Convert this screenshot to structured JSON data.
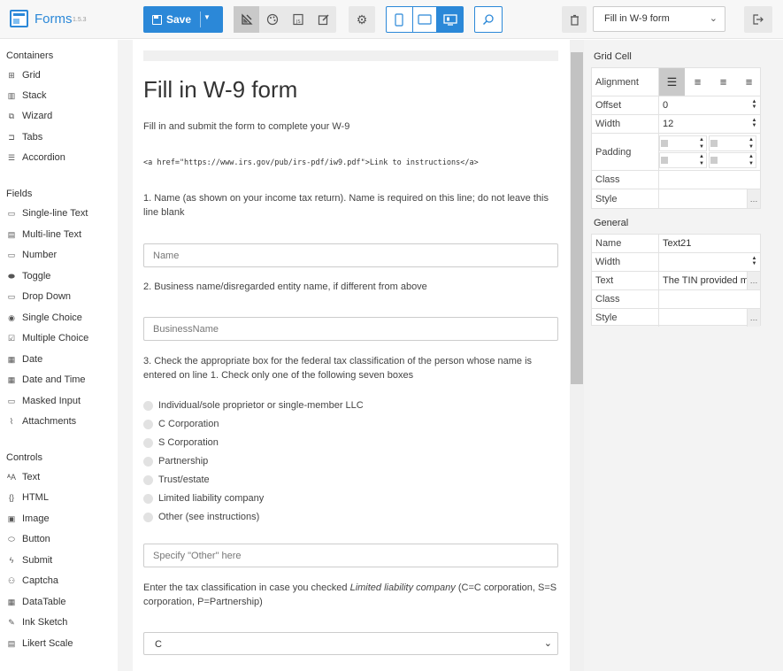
{
  "app": {
    "title": "Forms",
    "version": "1.5.3",
    "save_label": "Save"
  },
  "toolbar": {
    "form_select": "Fill in W-9 form"
  },
  "toolbox": {
    "containers_title": "Containers",
    "containers": [
      {
        "label": "Grid",
        "icon": "grid-icon"
      },
      {
        "label": "Stack",
        "icon": "stack-icon"
      },
      {
        "label": "Wizard",
        "icon": "wizard-icon"
      },
      {
        "label": "Tabs",
        "icon": "tabs-icon"
      },
      {
        "label": "Accordion",
        "icon": "accordion-icon"
      }
    ],
    "fields_title": "Fields",
    "fields": [
      {
        "label": "Single-line Text",
        "icon": "single-line-text-icon"
      },
      {
        "label": "Multi-line Text",
        "icon": "multi-line-text-icon"
      },
      {
        "label": "Number",
        "icon": "number-icon"
      },
      {
        "label": "Toggle",
        "icon": "toggle-icon"
      },
      {
        "label": "Drop Down",
        "icon": "drop-down-icon"
      },
      {
        "label": "Single Choice",
        "icon": "single-choice-icon"
      },
      {
        "label": "Multiple Choice",
        "icon": "multiple-choice-icon"
      },
      {
        "label": "Date",
        "icon": "date-icon"
      },
      {
        "label": "Date and Time",
        "icon": "date-time-icon"
      },
      {
        "label": "Masked Input",
        "icon": "masked-input-icon"
      },
      {
        "label": "Attachments",
        "icon": "attachments-icon"
      }
    ],
    "controls_title": "Controls",
    "controls": [
      {
        "label": "Text",
        "icon": "text-icon"
      },
      {
        "label": "HTML",
        "icon": "html-icon"
      },
      {
        "label": "Image",
        "icon": "image-icon"
      },
      {
        "label": "Button",
        "icon": "button-icon"
      },
      {
        "label": "Submit",
        "icon": "submit-icon"
      },
      {
        "label": "Captcha",
        "icon": "captcha-icon"
      },
      {
        "label": "DataTable",
        "icon": "datatable-icon"
      },
      {
        "label": "Ink Sketch",
        "icon": "ink-sketch-icon"
      },
      {
        "label": "Likert Scale",
        "icon": "likert-scale-icon"
      }
    ]
  },
  "form": {
    "title": "Fill in W-9 form",
    "intro": "Fill in and submit the form to complete your W-9",
    "link_html": "<a href=\"https://www.irs.gov/pub/irs-pdf/iw9.pdf\">Link to instructions</a>",
    "q1": "1. Name (as shown on your income tax return). Name is required on this line; do not leave this line blank",
    "name_placeholder": "Name",
    "q2": "2. Business name/disregarded entity name, if different from above",
    "business_placeholder": "BusinessName",
    "q3": "3. Check the appropriate box for the federal tax classification of the person whose name is entered on line 1. Check only one of the following seven boxes",
    "classifications": [
      "Individual/sole proprietor or single-member LLC",
      "C Corporation",
      "S Corporation",
      "Partnership",
      "Trust/estate",
      "Limited liability company",
      "Other (see instructions)"
    ],
    "other_placeholder": "Specify \"Other\" here",
    "tax_note_pre": "Enter the tax classification in case you checked ",
    "tax_note_em": "Limited liability company",
    "tax_note_post": " (C=C corporation, S=S corporation, P=Partnership)",
    "tax_select": "C"
  },
  "props": {
    "grid_cell_title": "Grid Cell",
    "alignment_label": "Alignment",
    "offset_label": "Offset",
    "offset_value": "0",
    "width_label": "Width",
    "width_value": "12",
    "padding_label": "Padding",
    "class_label": "Class",
    "style_label": "Style",
    "general_title": "General",
    "g_name_label": "Name",
    "g_name_value": "Text21",
    "g_width_label": "Width",
    "g_text_label": "Text",
    "g_text_value": "The TIN provided m",
    "g_class_label": "Class",
    "g_style_label": "Style"
  }
}
